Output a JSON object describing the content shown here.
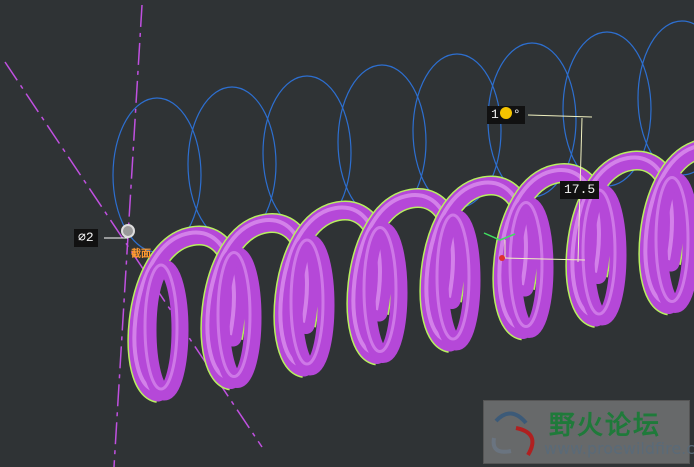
{
  "viewport": {
    "dimensions": [
      {
        "id": "angle",
        "prefix": "1",
        "suffix": "°"
      },
      {
        "id": "height",
        "text": "17.5"
      },
      {
        "id": "diameter",
        "text": "∅2"
      }
    ],
    "section_label": "截面",
    "colors": {
      "background": "#2f3335",
      "spring": "#b548d8",
      "sketch": "#2d6fd0",
      "centerline": "#c050e0",
      "edge": "#b8f060"
    }
  },
  "watermark": {
    "title": "野火论坛",
    "url": "www.proewildfire.cn"
  }
}
